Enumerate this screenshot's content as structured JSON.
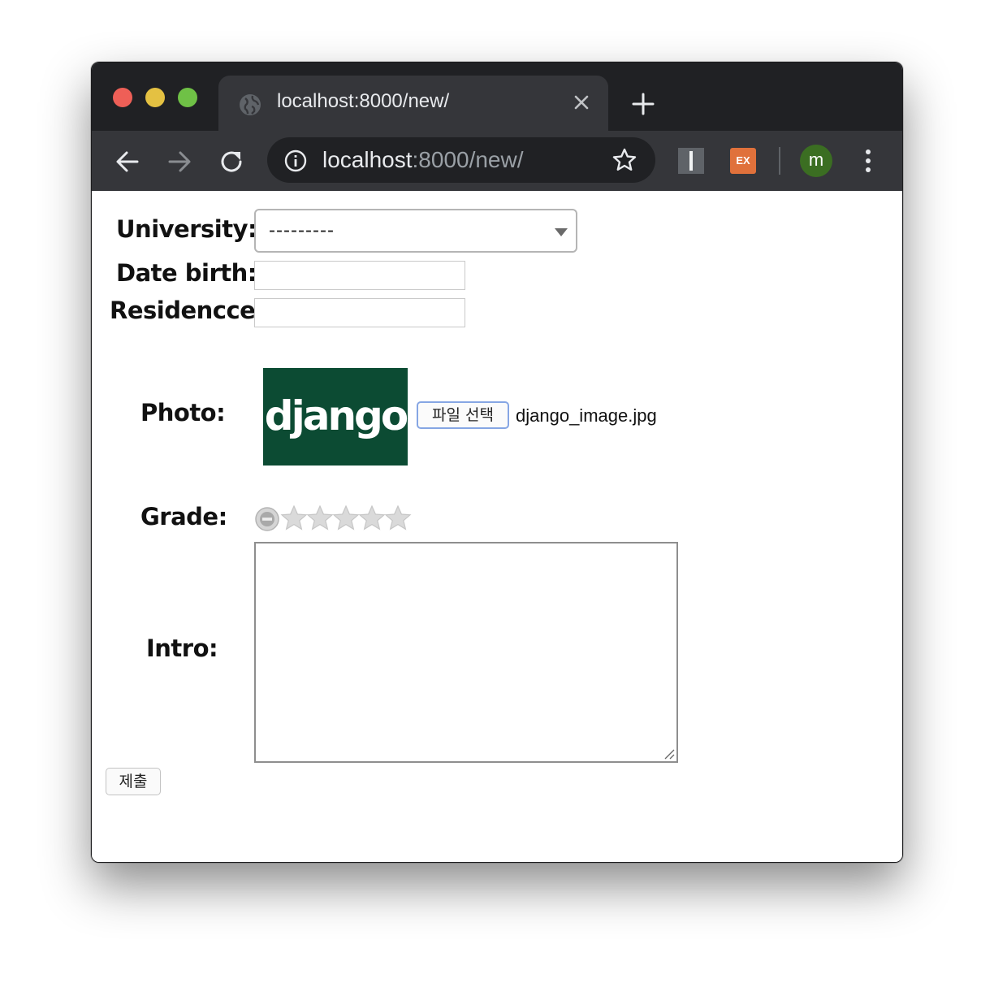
{
  "browser": {
    "tab": {
      "title": "localhost:8000/new/",
      "icon": "globe-icon",
      "close_icon": "close-icon"
    },
    "new_tab_icon": "plus-icon",
    "toolbar": {
      "back_icon": "back-arrow-icon",
      "forward_icon": "forward-arrow-icon",
      "reload_icon": "reload-icon",
      "info_icon": "info-icon",
      "bookmark_icon": "star-outline-icon"
    },
    "omnibox": {
      "host": "localhost",
      "rest": ":8000/new/"
    },
    "extensions": [
      {
        "name": "ext-i",
        "label": "I"
      },
      {
        "name": "ext-ex",
        "label": "EX",
        "color": "#e0713b"
      }
    ],
    "profile": {
      "initial": "m",
      "color": "#3b6e22"
    },
    "menu_icon": "kebab-menu-icon"
  },
  "form": {
    "university": {
      "label": "University:",
      "value": "---------"
    },
    "date_birth": {
      "label": "Date birth:",
      "value": ""
    },
    "residence": {
      "label": "Residencce:",
      "value": ""
    },
    "photo": {
      "label": "Photo:",
      "thumbnail_text": "django",
      "button": "파일 선택",
      "filename": "django_image.jpg"
    },
    "grade": {
      "label": "Grade:",
      "rating": 0,
      "max": 5
    },
    "intro": {
      "label": "Intro:",
      "value": ""
    },
    "submit": "제출"
  }
}
